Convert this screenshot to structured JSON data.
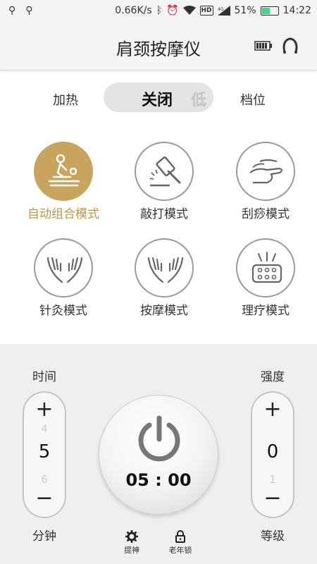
{
  "status_bar": {
    "speed": "0.66K/s",
    "battery_percent": "51%",
    "battery_level": 0.51,
    "time": "14:22",
    "network": "4G",
    "hd": "HD"
  },
  "header": {
    "title": "肩颈按摩仪"
  },
  "heat": {
    "label": "加热",
    "state": "关闭",
    "next_state": "低",
    "gear_label": "档位"
  },
  "modes": [
    {
      "label": "自动组合模式",
      "active": true,
      "icon": "massage-person-icon"
    },
    {
      "label": "敲打模式",
      "active": false,
      "icon": "hammer-icon"
    },
    {
      "label": "刮痧模式",
      "active": false,
      "icon": "scraping-hand-icon"
    },
    {
      "label": "针灸模式",
      "active": false,
      "icon": "hands-icon"
    },
    {
      "label": "按摩模式",
      "active": false,
      "icon": "hands-icon"
    },
    {
      "label": "理疗模式",
      "active": false,
      "icon": "therapy-pad-icon"
    }
  ],
  "time_control": {
    "label": "时间",
    "plus": "+",
    "minus": "−",
    "prev": "4",
    "value": "5",
    "next": "6",
    "unit": "分钟"
  },
  "intensity_control": {
    "label": "强度",
    "plus": "+",
    "minus": "−",
    "value": "0",
    "next": "1",
    "unit": "等级"
  },
  "timer": "05 : 00",
  "bottom_buttons": {
    "refresh": "提神",
    "elder_lock": "老年锁"
  },
  "colors": {
    "accent": "#c8a45c",
    "battery_green": "#3ddc84"
  }
}
